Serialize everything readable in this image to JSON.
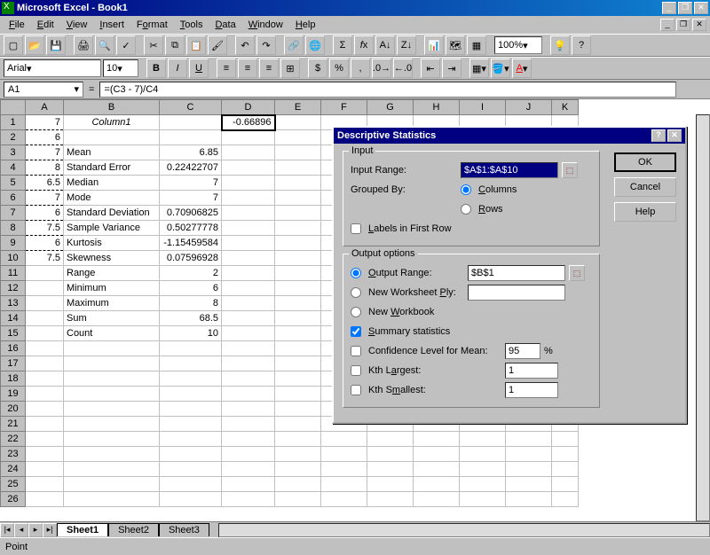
{
  "title": "Microsoft Excel - Book1",
  "menus": [
    "File",
    "Edit",
    "View",
    "Insert",
    "Format",
    "Tools",
    "Data",
    "Window",
    "Help"
  ],
  "font_name": "Arial",
  "font_size": "10",
  "zoom": "100%",
  "namebox": "A1",
  "formula": "=(C3 - 7)/C4",
  "columns": [
    "A",
    "B",
    "C",
    "D",
    "E",
    "F",
    "G",
    "H",
    "I",
    "J",
    "K"
  ],
  "rows": [
    {
      "n": 1,
      "a": "7",
      "b": "Column1",
      "c": "",
      "d": "-0.66896"
    },
    {
      "n": 2,
      "a": "6"
    },
    {
      "n": 3,
      "a": "7",
      "b": "Mean",
      "c": "6.85"
    },
    {
      "n": 4,
      "a": "8",
      "b": "Standard Error",
      "c": "0.22422707"
    },
    {
      "n": 5,
      "a": "6.5",
      "b": "Median",
      "c": "7"
    },
    {
      "n": 6,
      "a": "7",
      "b": "Mode",
      "c": "7"
    },
    {
      "n": 7,
      "a": "6",
      "b": "Standard Deviation",
      "c": "0.70906825"
    },
    {
      "n": 8,
      "a": "7.5",
      "b": "Sample Variance",
      "c": "0.50277778"
    },
    {
      "n": 9,
      "a": "6",
      "b": "Kurtosis",
      "c": "-1.15459584"
    },
    {
      "n": 10,
      "a": "7.5",
      "b": "Skewness",
      "c": "0.07596928"
    },
    {
      "n": 11,
      "b": "Range",
      "c": "2"
    },
    {
      "n": 12,
      "b": "Minimum",
      "c": "6"
    },
    {
      "n": 13,
      "b": "Maximum",
      "c": "8"
    },
    {
      "n": 14,
      "b": "Sum",
      "c": "68.5"
    },
    {
      "n": 15,
      "b": "Count",
      "c": "10"
    },
    {
      "n": 16
    },
    {
      "n": 17
    },
    {
      "n": 18
    },
    {
      "n": 19
    },
    {
      "n": 20
    },
    {
      "n": 21
    },
    {
      "n": 22
    },
    {
      "n": 23
    },
    {
      "n": 24
    },
    {
      "n": 25
    },
    {
      "n": 26
    }
  ],
  "sheets": [
    "Sheet1",
    "Sheet2",
    "Sheet3"
  ],
  "status": "Point",
  "dialog": {
    "title": "Descriptive Statistics",
    "input_legend": "Input",
    "output_legend": "Output options",
    "input_range_label": "Input Range:",
    "input_range": "$A$1:$A$10",
    "grouped_label": "Grouped By:",
    "grouped_cols": "Columns",
    "grouped_rows": "Rows",
    "labels_first": "Labels in First Row",
    "output_range_label": "Output Range:",
    "output_range": "$B$1",
    "new_ws": "New Worksheet Ply:",
    "new_wb": "New Workbook",
    "summary": "Summary statistics",
    "conf_label": "Confidence Level for Mean:",
    "conf_val": "95",
    "conf_pct": "%",
    "kth_largest": "Kth Largest:",
    "kth_smallest": "Kth Smallest:",
    "k_val": "1",
    "ok": "OK",
    "cancel": "Cancel",
    "help": "Help"
  }
}
